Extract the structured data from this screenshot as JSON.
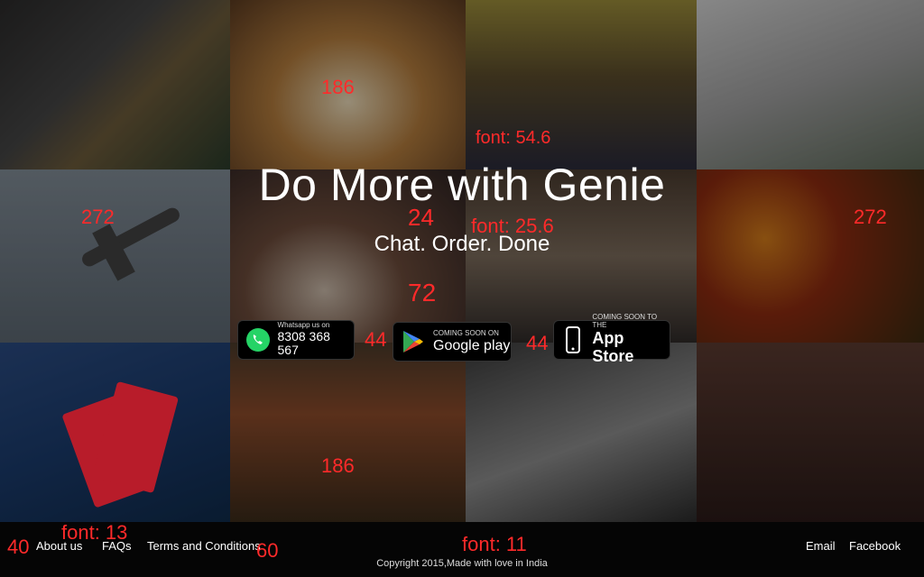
{
  "hero": {
    "title": "Do More with Genie",
    "subtitle": "Chat. Order. Done"
  },
  "badges": {
    "whatsapp": {
      "small": "Whatsapp us on",
      "number": "8308 368 567",
      "icon": "whatsapp-icon"
    },
    "google_play": {
      "small": "COMING SOON ON",
      "label": "Google play",
      "icon": "google-play-icon"
    },
    "app_store": {
      "small": "COMING SOON TO THE",
      "label": "App Store",
      "icon": "phone-icon"
    }
  },
  "annotations": {
    "a1": "186",
    "a2": "font: 54.6",
    "a3": "272",
    "a4": "24",
    "a5": "font: 25.6",
    "a6": "272",
    "a7": "72",
    "a8": "44",
    "a9": "44",
    "a10": "186",
    "a11": "font: 13",
    "a12": "40",
    "a13": "60",
    "a14": "font: 11"
  },
  "footer": {
    "left_links": [
      "About us",
      "FAQs",
      "Terms and Conditions"
    ],
    "right_links": [
      "Email",
      "Facebook"
    ],
    "copyright": "Copyright 2015,Made with love in India"
  },
  "colors": {
    "annotation": "#ff2a2a",
    "footer_bg": "#050505",
    "text": "#ffffff"
  }
}
